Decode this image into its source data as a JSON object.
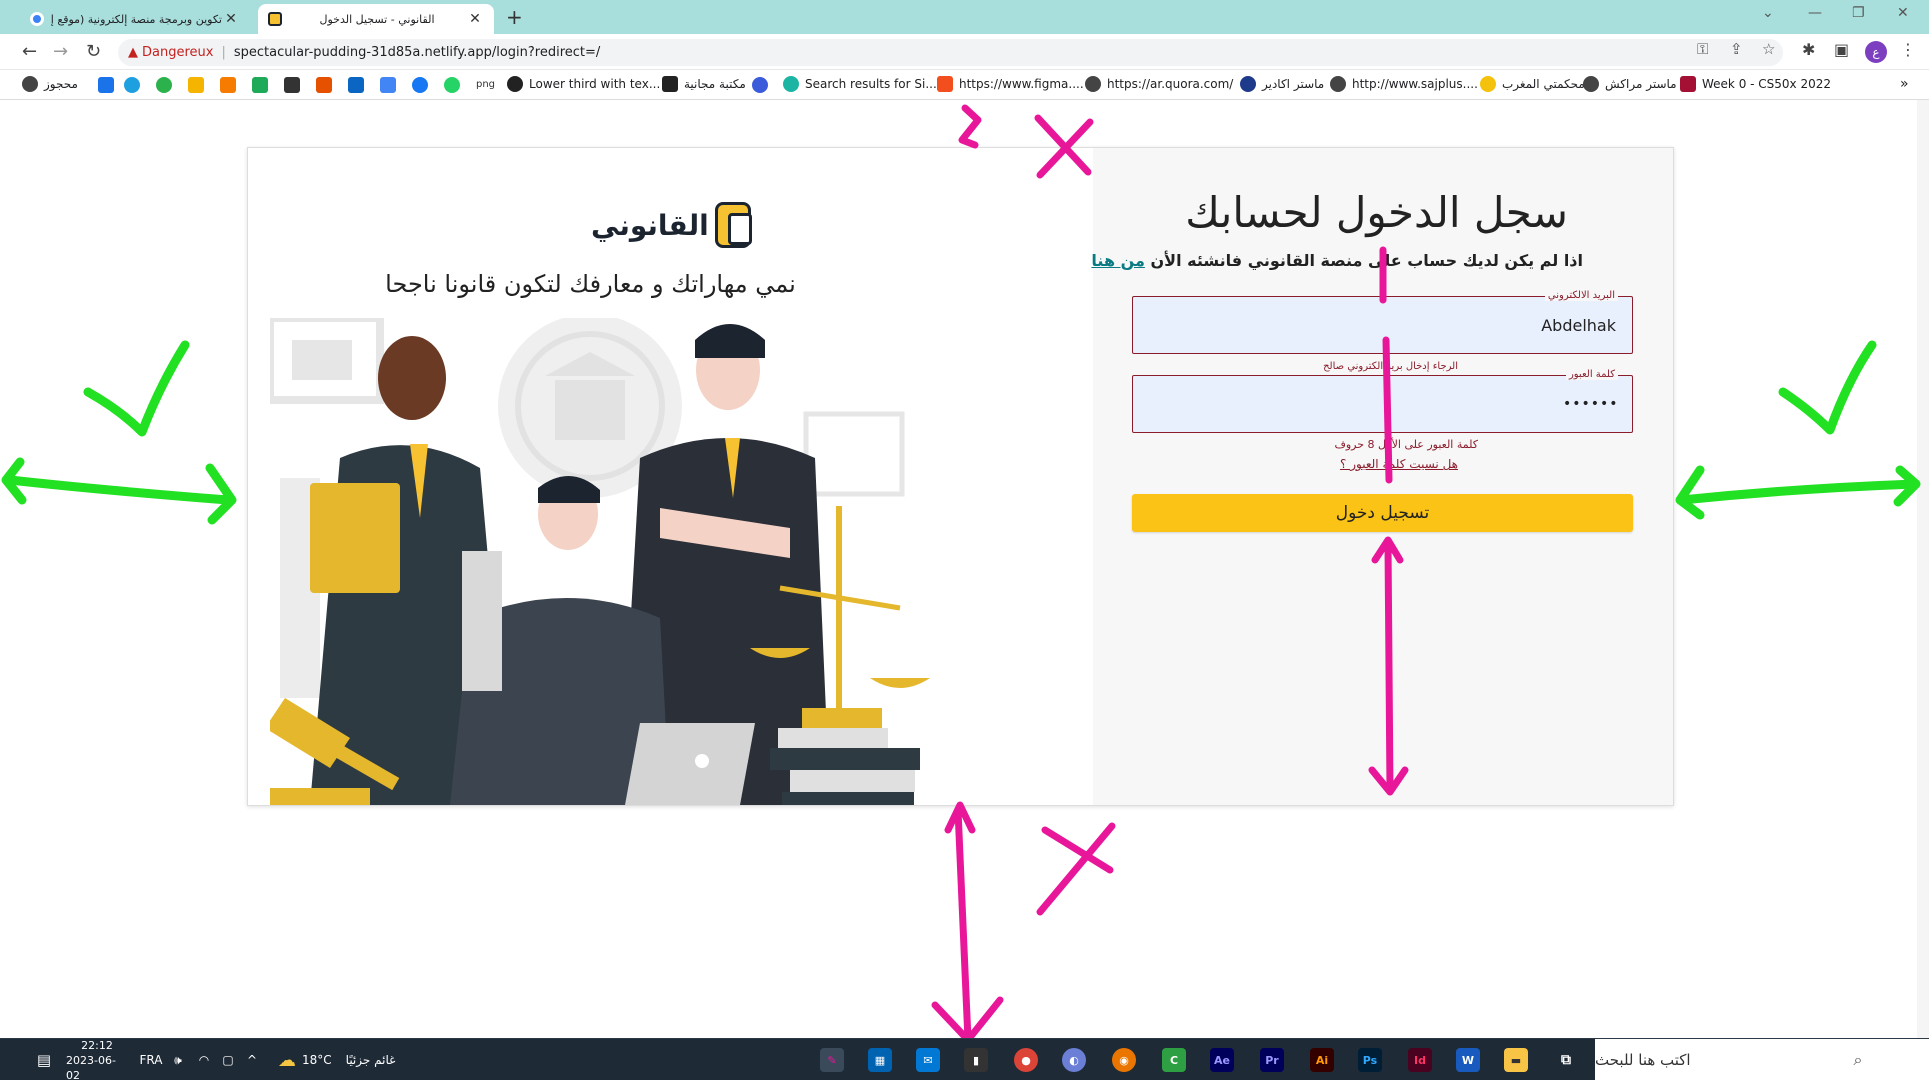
{
  "browser": {
    "tabs": [
      {
        "title": "تكوين وبرمجة منصة إلكترونية (موقع إلكترو"
      },
      {
        "title": "القانوني - تسجيل الدخول"
      }
    ],
    "security_label": "Dangereux",
    "url": "spectacular-pudding-31d85a.netlify.app/login?redirect=/",
    "profile_initial": "ع"
  },
  "bookmarks": [
    {
      "label": "محجوز",
      "icon": "globe-icon"
    },
    {
      "label": "Lower third with tex...",
      "icon": "m-icon"
    },
    {
      "label": "مكتبة مجانية",
      "icon": "library-icon"
    },
    {
      "label": "Search results for Si...",
      "icon": "vuetify-icon"
    },
    {
      "label": "https://www.figma....",
      "icon": "figma-icon"
    },
    {
      "label": "https://ar.quora.com/",
      "icon": "globe-icon"
    },
    {
      "label": "ماستر اكادير",
      "icon": "moon-icon"
    },
    {
      "label": "http://www.sajplus....",
      "icon": "globe-icon"
    },
    {
      "label": "محكمتي المغرب",
      "icon": "sun-icon"
    },
    {
      "label": "ماستر مراكش",
      "icon": "globe-icon"
    },
    {
      "label": "Week 0 - CS50x 2022",
      "icon": "harvard-icon"
    }
  ],
  "page": {
    "logo_text": "القانوني",
    "tagline": "نمي مهاراتك و معارفك لتكون قانونا ناجحا",
    "heading": "سجل الدخول لحسابك",
    "subline_text": "اذا لم يكن لديك حساب على منصة القانوني فانشئه الأن",
    "subline_link": "من هنا",
    "email_label": "البريد الالكتروني",
    "email_value": "Abdelhak",
    "email_error": "الرجاء إدخال بريد الكتروني صالح",
    "password_label": "كلمة العبور",
    "password_value": "•••••••••",
    "password_error": "كلمة العبور على الأقل 8 حروف",
    "forgot_link": "هل نسيت كلمة العبور ؟",
    "login_button": "تسجيل دخول"
  },
  "taskbar": {
    "time": "22:12",
    "date": "2023-06-02",
    "language": "FRA",
    "weather_temp": "18°C",
    "weather_text": "غائم جزئيًا",
    "search_placeholder": "اكتب هنا للبحث"
  },
  "colors": {
    "tabstrip": "#a8dedc",
    "accent_yellow": "#fbc316",
    "error_red": "#8a1c2b",
    "link_teal": "#0a7b83",
    "annotation_green": "#22e022",
    "annotation_pink": "#e8179a"
  }
}
